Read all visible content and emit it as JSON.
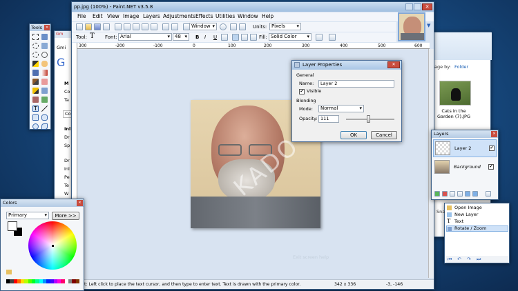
{
  "desktop_bg": "#1d5289",
  "main_window": {
    "title": "pp.jpg (100%) - Paint.NET v3.5.8"
  },
  "menu": [
    "File",
    "Edit",
    "View",
    "Image",
    "Layers",
    "Adjustments",
    "Effects",
    "Utilities",
    "Window",
    "Help"
  ],
  "toolbar": {
    "window_label": "Window",
    "units_label": "Units:",
    "units_value": "Pixels"
  },
  "toolbar2": {
    "tool_label": "Tool:",
    "font_label": "Font:",
    "font_value": "Arial",
    "size_value": "48",
    "fill_label": "Fill:",
    "fill_value": "Solid Color",
    "bold": "B",
    "italic": "I",
    "underline": "U"
  },
  "ruler": {
    "ticks": [
      "300",
      "-200",
      "-100",
      "0",
      "100",
      "200",
      "300",
      "400",
      "500",
      "600"
    ]
  },
  "canvas": {
    "watermark": "KADO",
    "faint_text": "Exit screen help"
  },
  "layer_props": {
    "title": "Layer Properties",
    "general": "General",
    "name_label": "Name:",
    "name_value": "Layer 2",
    "visible_label": "Visible",
    "blending": "Blending",
    "mode_label": "Mode:",
    "mode_value": "Normal",
    "opacity_label": "Opacity:",
    "opacity_value": "111",
    "ok": "OK",
    "cancel": "Cancel"
  },
  "tools_panel": {
    "title": "Tools"
  },
  "colors_panel": {
    "title": "Colors",
    "mode": "Primary",
    "more": "More >>"
  },
  "layers_panel": {
    "title": "Layers",
    "items": [
      {
        "name": "Layer 2",
        "checked": "✔"
      },
      {
        "name": "Background",
        "checked": "✔"
      }
    ]
  },
  "history_panel": {
    "items": [
      "Open Image",
      "New Layer",
      "Text",
      "Rotate / Zoom"
    ],
    "label": "Sna"
  },
  "explorer": {
    "arrange": "age by:",
    "folder": "Folder",
    "file_caption": "Cats in the Garden (7).JPG"
  },
  "browser": {
    "tab": "Gm",
    "fragments": [
      "Gmi",
      "G",
      "M",
      "Co",
      "Ta",
      "Co",
      "Inl",
      "Dr",
      "Sp",
      "Dr",
      "Inl",
      "Pe",
      "Te",
      "W",
      "Ev"
    ]
  },
  "status": {
    "hint": "t: Left click to place the text cursor, and then type to enter text. Text is drawn with the primary color.",
    "size": "342 x 336",
    "pos": "-3, -146"
  },
  "palette": [
    "#000000",
    "#404040",
    "#ff0000",
    "#ff6a00",
    "#ffd800",
    "#b6ff00",
    "#4cff00",
    "#00ff21",
    "#00ff90",
    "#00ffff",
    "#0094ff",
    "#0026ff",
    "#4800ff",
    "#b200ff",
    "#ff00dc",
    "#ff006e",
    "#ffffff",
    "#808080",
    "#7f0000",
    "#7f3300"
  ]
}
